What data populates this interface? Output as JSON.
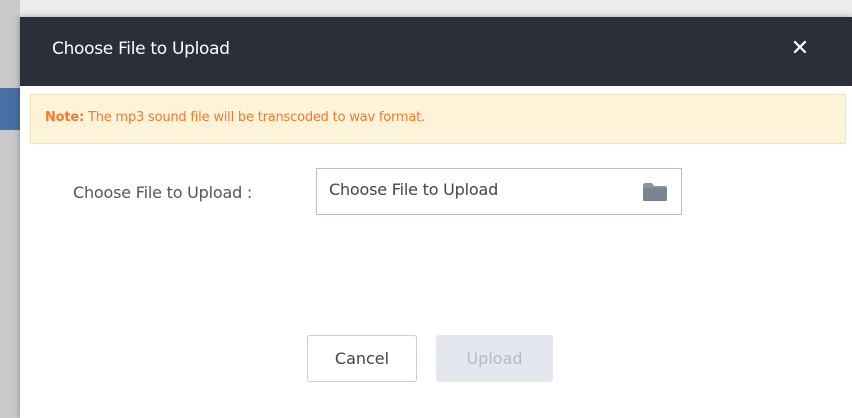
{
  "dialog": {
    "title": "Choose File to Upload",
    "close_icon": "close-icon",
    "close_glyph": "✕"
  },
  "note": {
    "label": "Note:",
    "message": " The mp3 sound file will be transcoded to wav format."
  },
  "form": {
    "field_label": "Choose File to Upload :",
    "file_input_placeholder": "Choose File to Upload",
    "file_input_icon": "folder-icon"
  },
  "buttons": {
    "cancel_label": "Cancel",
    "upload_label": "Upload"
  },
  "colors": {
    "header_bg": "#2b2f3a",
    "note_bg": "#fcf3d9",
    "note_text": "#f07b2d",
    "upload_disabled_bg": "#e4e8ee",
    "upload_disabled_text": "#b5bcc7"
  }
}
